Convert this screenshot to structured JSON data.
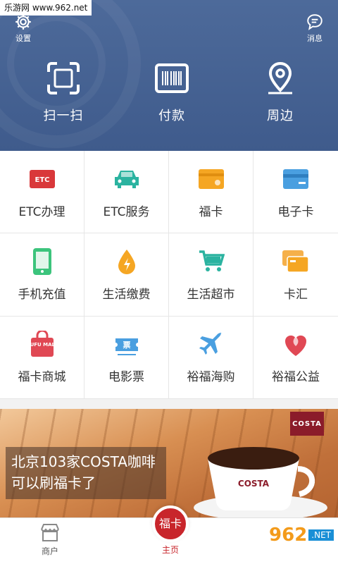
{
  "site_tag": "乐游网 www.962.net",
  "header": {
    "settings_label": "设置",
    "messages_label": "消息",
    "quick_actions": [
      {
        "label": "扫一扫",
        "icon": "scan-icon"
      },
      {
        "label": "付款",
        "icon": "barcode-icon"
      },
      {
        "label": "周边",
        "icon": "location-pin-icon"
      }
    ]
  },
  "grid": [
    {
      "label": "ETC办理",
      "icon": "etc-card-icon"
    },
    {
      "label": "ETC服务",
      "icon": "car-icon"
    },
    {
      "label": "福卡",
      "icon": "fuka-card-icon"
    },
    {
      "label": "电子卡",
      "icon": "e-card-icon"
    },
    {
      "label": "手机充值",
      "icon": "phone-icon"
    },
    {
      "label": "生活缴费",
      "icon": "utility-drop-icon"
    },
    {
      "label": "生活超市",
      "icon": "shopping-cart-icon"
    },
    {
      "label": "卡汇",
      "icon": "cards-icon"
    },
    {
      "label": "福卡商城",
      "icon": "mall-bag-icon"
    },
    {
      "label": "电影票",
      "icon": "ticket-icon"
    },
    {
      "label": "裕福海购",
      "icon": "airplane-icon"
    },
    {
      "label": "裕福公益",
      "icon": "charity-heart-icon"
    }
  ],
  "etc_badge": "ETC",
  "yufu_mall_badge": "YUFU MALL",
  "ticket_badge": "票",
  "banner": {
    "line1": "北京103家COSTA咖啡",
    "line2": "可以刷福卡了",
    "brand": "COSTA",
    "cup_brand": "COSTA"
  },
  "bottom_nav": {
    "merchant_label": "商户",
    "home_badge": "福卡",
    "home_label": "主页"
  },
  "corner_mark": {
    "num": "962",
    "net": ".NET"
  },
  "colors": {
    "header_bg": "#4d6a9a",
    "accent_red": "#c8252b",
    "etc_red": "#d9383a",
    "teal": "#2bb3a0",
    "orange": "#f5a623",
    "blue": "#4a9fe0",
    "green": "#3cc47c"
  }
}
